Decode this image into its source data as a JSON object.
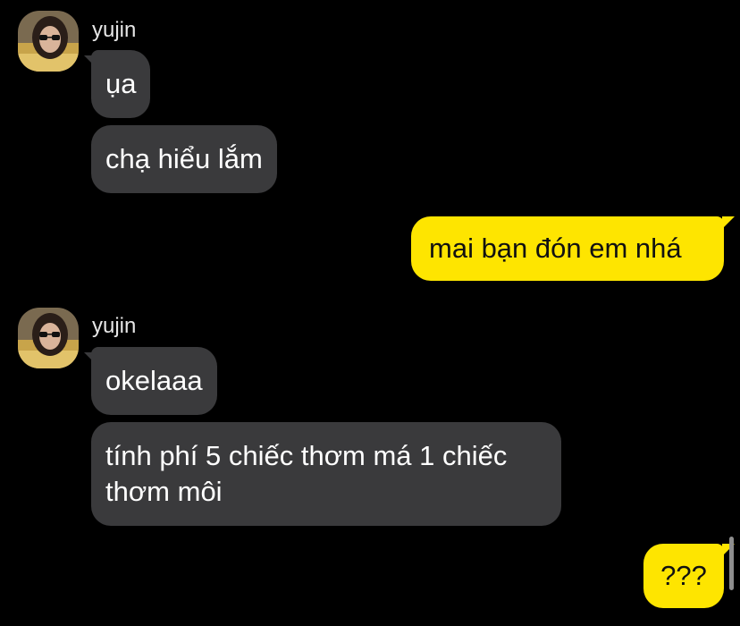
{
  "messages": [
    {
      "sender": "yujin",
      "text": "ụa"
    },
    {
      "sender": "yujin",
      "text": "chạ hiểu lắm"
    },
    {
      "sender": "me",
      "text": "mai bạn đón em nhá"
    },
    {
      "sender": "yujin",
      "text": "okelaaa"
    },
    {
      "sender": "yujin",
      "text": "tính phí 5 chiếc thơm má 1 chiếc thơm môi"
    },
    {
      "sender": "me",
      "text": "???"
    }
  ],
  "colors": {
    "background": "#000000",
    "incoming_bubble": "#3a3a3c",
    "outgoing_bubble": "#fee500"
  },
  "icons": {
    "avatar": "profile-photo"
  }
}
